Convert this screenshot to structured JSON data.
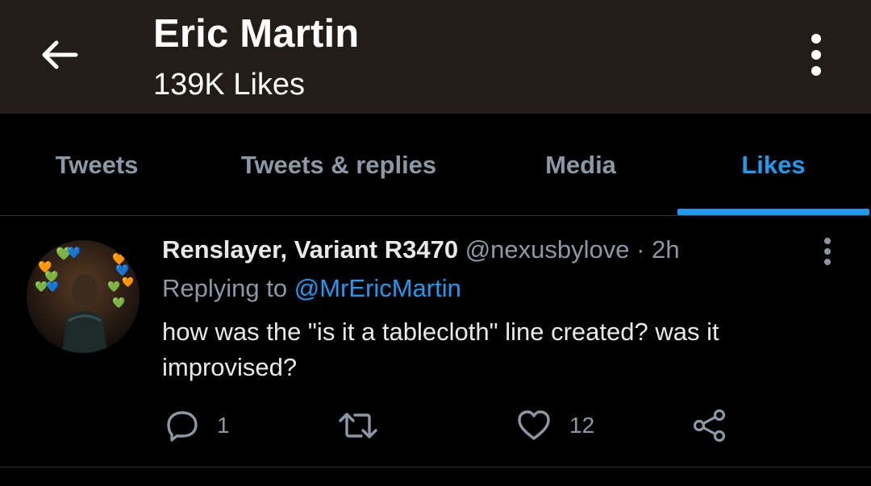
{
  "header": {
    "title": "Eric Martin",
    "subtitle": "139K Likes",
    "bg_color": "#231d18"
  },
  "tabs": [
    {
      "label": "Tweets",
      "active": false
    },
    {
      "label": "Tweets & replies",
      "active": false
    },
    {
      "label": "Media",
      "active": false
    },
    {
      "label": "Likes",
      "active": true
    }
  ],
  "accent_color": "#1d9bf0",
  "tweet": {
    "author_name": "Renslayer, Variant R3470",
    "handle": "@nexusbylove",
    "separator": "·",
    "time": "2h",
    "replying_prefix": "Replying to",
    "replying_to": "@MrEricMartin",
    "text": "how was the \"is it a tablecloth\" line created? was it improvised?",
    "actions": {
      "reply_icon": "reply-icon",
      "reply_count": "1",
      "retweet_icon": "retweet-icon",
      "like_icon": "heart-icon",
      "like_count": "12",
      "share_icon": "share-icon"
    }
  }
}
